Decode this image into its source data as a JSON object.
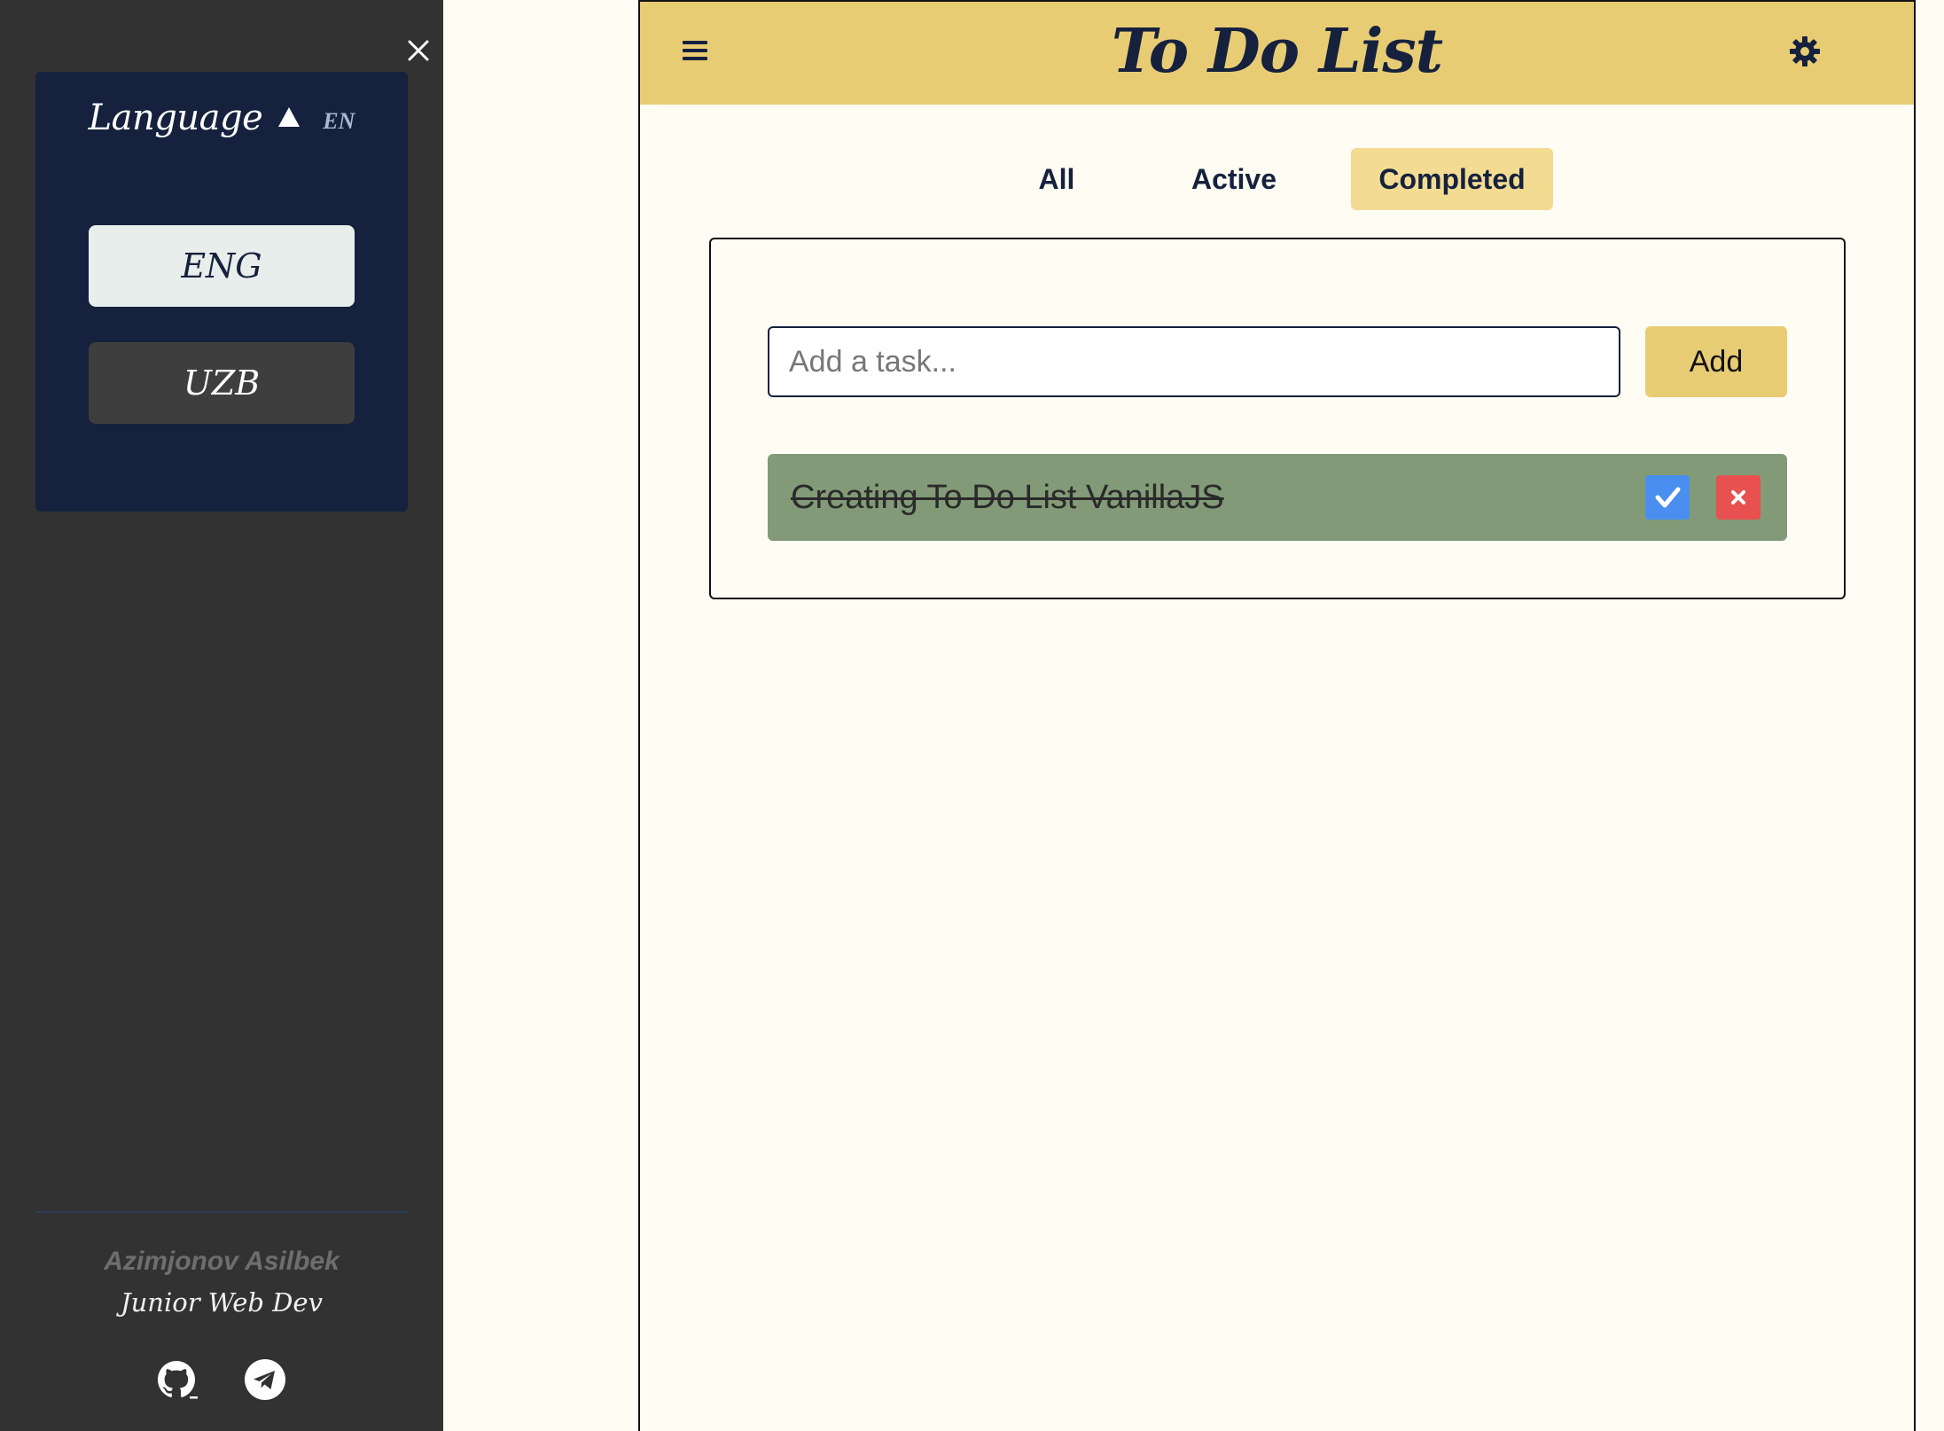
{
  "sidebar": {
    "close_icon": "close-icon",
    "language": {
      "title": "Language",
      "current_code": "EN",
      "caret_icon": "caret-up-icon",
      "options": [
        {
          "label": "ENG",
          "selected": true
        },
        {
          "label": "UZB",
          "selected": false
        }
      ]
    },
    "author": {
      "name": "Azimjonov Asilbek",
      "role": "Junior Web Dev"
    },
    "social": [
      {
        "icon": "github-icon"
      },
      {
        "icon": "telegram-icon"
      }
    ]
  },
  "header": {
    "menu_icon": "hamburger-menu-icon",
    "title": "To Do List",
    "theme_icon": "gear-icon"
  },
  "tabs": [
    {
      "label": "All",
      "selected": false
    },
    {
      "label": "Active",
      "selected": false
    },
    {
      "label": "Completed",
      "selected": true
    }
  ],
  "form": {
    "input_value": "",
    "input_placeholder": "Add a task...",
    "add_label": "Add"
  },
  "tasks": [
    {
      "text": "Creating To Do List VanillaJS",
      "completed": true
    }
  ],
  "colors": {
    "header_bg": "#e8cc74",
    "selected_tab_bg": "#f3dc92",
    "sidebar_bg": "#323232",
    "language_panel_bg": "#15213d",
    "task_completed_bg": "#839a78",
    "check_button": "#4a8ff0",
    "delete_button": "#e8514f",
    "page_bg": "#fefcf3"
  }
}
